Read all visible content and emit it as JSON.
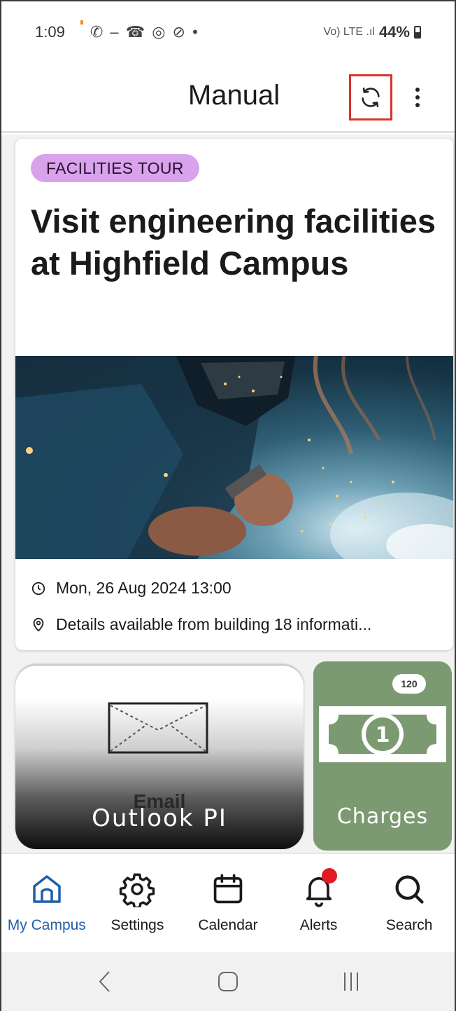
{
  "status_bar": {
    "time": "1:09",
    "left_icons": "✆ ‒ ☎ ◎ ⊘ •",
    "network": "Vo) LTE .ıl",
    "battery": "44%"
  },
  "app_bar": {
    "title": "Manual",
    "refresh_icon": "refresh-icon",
    "more_icon": "more-vertical-icon",
    "highlight_color": "#d9342b"
  },
  "event_card": {
    "tag": "FACILITIES TOUR",
    "tag_color": "#d8a3ea",
    "title": "Visit engineering facilities at Highfield Campus",
    "datetime": "Mon, 26 Aug 2024 13:00",
    "location": "Details available from building 18 informati..."
  },
  "tiles": {
    "email": {
      "ghost_label": "Email",
      "label": "Outlook PI"
    },
    "charges": {
      "badge": "120",
      "label": "Charges",
      "color": "#7c9a72"
    }
  },
  "bottom_nav": {
    "items": [
      {
        "label": "My Campus",
        "icon": "home-icon",
        "active": true
      },
      {
        "label": "Settings",
        "icon": "gear-icon",
        "active": false
      },
      {
        "label": "Calendar",
        "icon": "calendar-icon",
        "active": false
      },
      {
        "label": "Alerts",
        "icon": "bell-icon",
        "active": false,
        "has_badge": true
      },
      {
        "label": "Search",
        "icon": "search-icon",
        "active": false
      }
    ],
    "active_color": "#1f5fa8"
  },
  "system_nav": {
    "back_icon": "back-chevron-icon",
    "home_icon": "home-square-icon",
    "recents_icon": "recents-icon"
  }
}
